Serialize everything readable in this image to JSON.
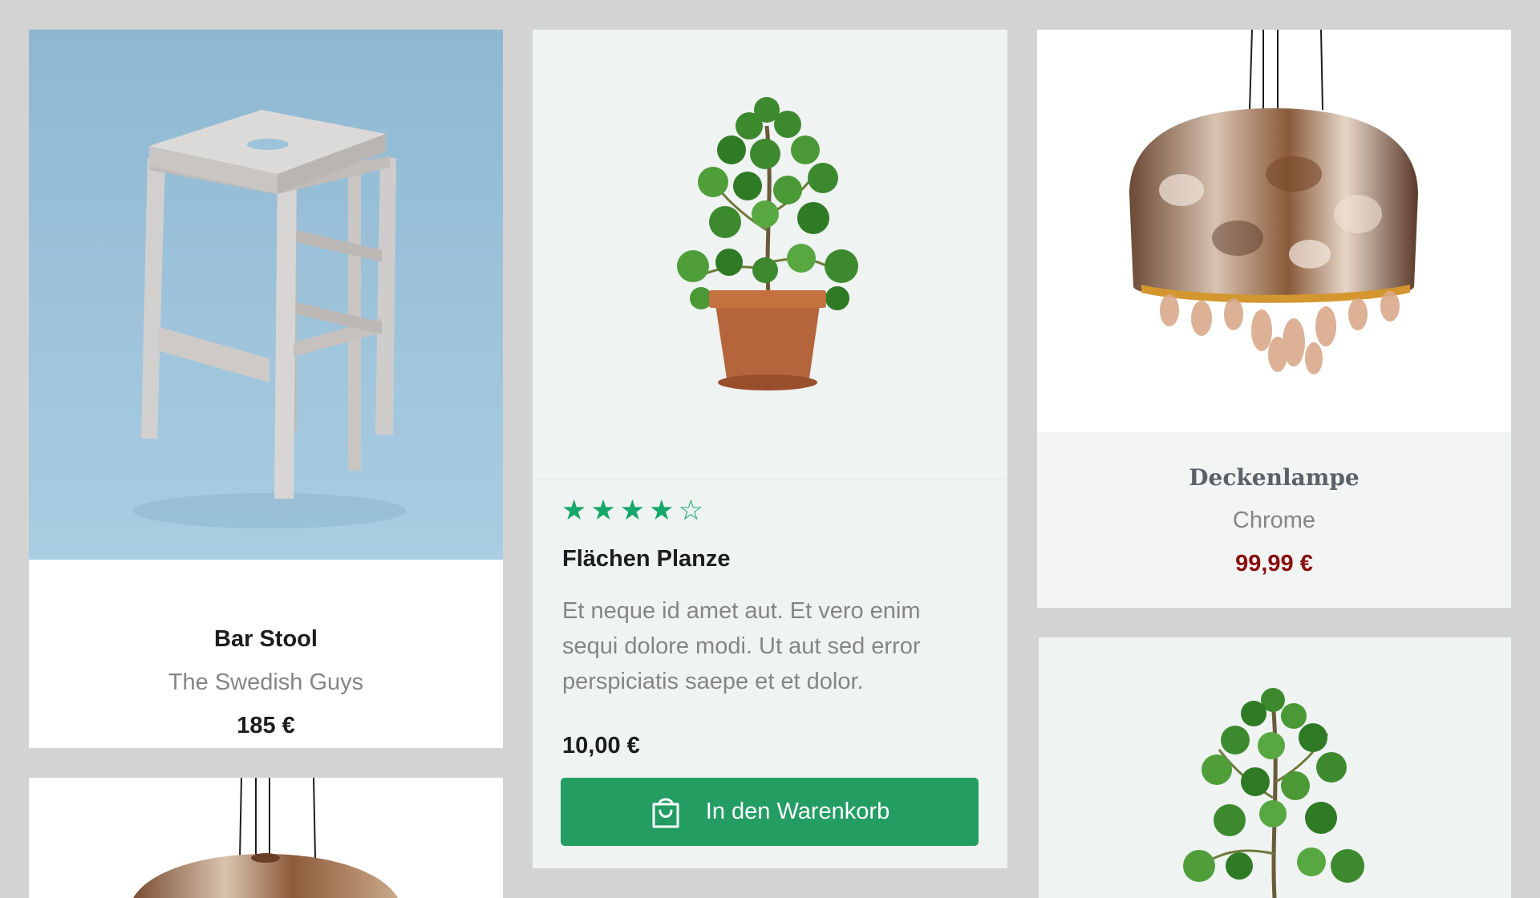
{
  "products": {
    "stool": {
      "title": "Bar Stool",
      "brand": "The Swedish Guys",
      "price": "185 €",
      "image": "bar-stool-photo"
    },
    "plant": {
      "rating": 4,
      "rating_max": 5,
      "stars": [
        "★",
        "★",
        "★",
        "★",
        "☆"
      ],
      "title": "Flächen Planze",
      "description": "Et neque id amet aut. Et vero enim sequi dolore modi. Ut aut sed error perspiciatis saepe et et dolor.",
      "price": "10,00 €",
      "cart_button": "In den Warenkorb",
      "cart_icon": "shopping-bag-icon",
      "image": "potted-plant-photo"
    },
    "lamp": {
      "title": "Deckenlampe",
      "brand": "Chrome",
      "price": "99,99 €",
      "image": "chrome-pendant-lamp-photo"
    }
  },
  "colors": {
    "page_bg": "#d3d3d3",
    "accent_green": "#239d62",
    "star_green": "#14a86a",
    "price_red": "#8a0d0d",
    "muted_text": "#858585",
    "dark_text": "#1d1d1f"
  }
}
